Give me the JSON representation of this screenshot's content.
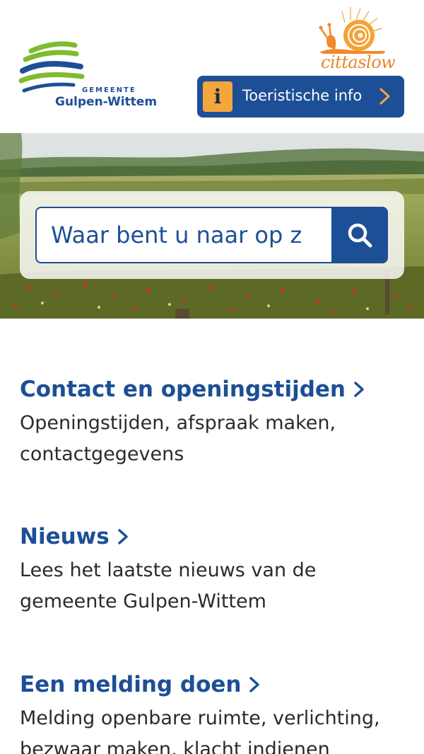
{
  "header": {
    "logo": {
      "gemeente": "GEMEENTE",
      "name": "Gulpen-Wittem"
    },
    "cittaslow": {
      "text": "cittaslow",
      "color": "#e8862a"
    },
    "tourist_button": {
      "icon": "info-icon",
      "icon_glyph": "i",
      "label": "Toeristische info"
    }
  },
  "hero": {
    "search": {
      "placeholder": "Waar bent u naar op z",
      "icon": "search-icon"
    }
  },
  "items": [
    {
      "title": "Contact en openingstijden",
      "description": "Openingstijden, afspraak maken, contactgegevens"
    },
    {
      "title": "Nieuws",
      "description": "Lees het laatste nieuws van de gemeente Gulpen-Wittem"
    },
    {
      "title": "Een melding doen",
      "description": "Melding openbare ruimte, verlichting, bezwaar maken, klacht indienen"
    }
  ],
  "colors": {
    "primary": "#1d4f96",
    "accent": "#f3a73b",
    "logo_green": "#7dbb2f"
  }
}
